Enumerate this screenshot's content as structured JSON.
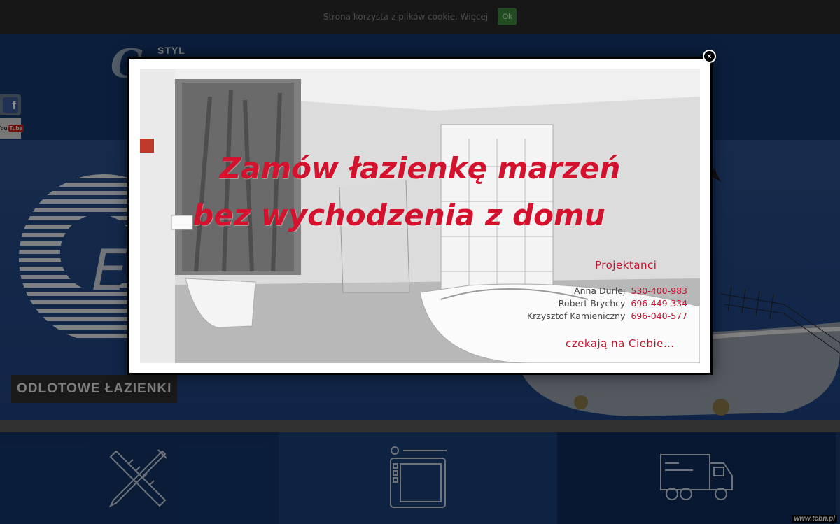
{
  "cookie": {
    "text": "Strona korzysta z plików cookie. Więcej",
    "ok_label": "Ok"
  },
  "header": {
    "logo_letter": "G",
    "logo_text": "STYL"
  },
  "social": {
    "facebook_label": "f",
    "youtube_label_1": "You",
    "youtube_label_2": "Tube"
  },
  "hero": {
    "caption": "ODLOTOWE ŁAZIENKI"
  },
  "modal": {
    "close_label": "×",
    "title_line_1": "Zamów łazienkę marzeń",
    "title_line_2": "bez wychodzenia z domu",
    "designers_heading": "Projektanci",
    "designers": [
      {
        "name": "Anna Durlej",
        "phone": "530-400-983"
      },
      {
        "name": "Robert Brychcy",
        "phone": "696-449-334"
      },
      {
        "name": "Krzysztof Kamieniczny",
        "phone": "696-040-577"
      }
    ],
    "footer": "czekają na Ciebie..."
  },
  "watermark": "www.tcbn.pl",
  "colors": {
    "accent_red": "#d4122e",
    "header_blue": "#15376e",
    "cookie_ok_green": "#3c8a3c"
  }
}
